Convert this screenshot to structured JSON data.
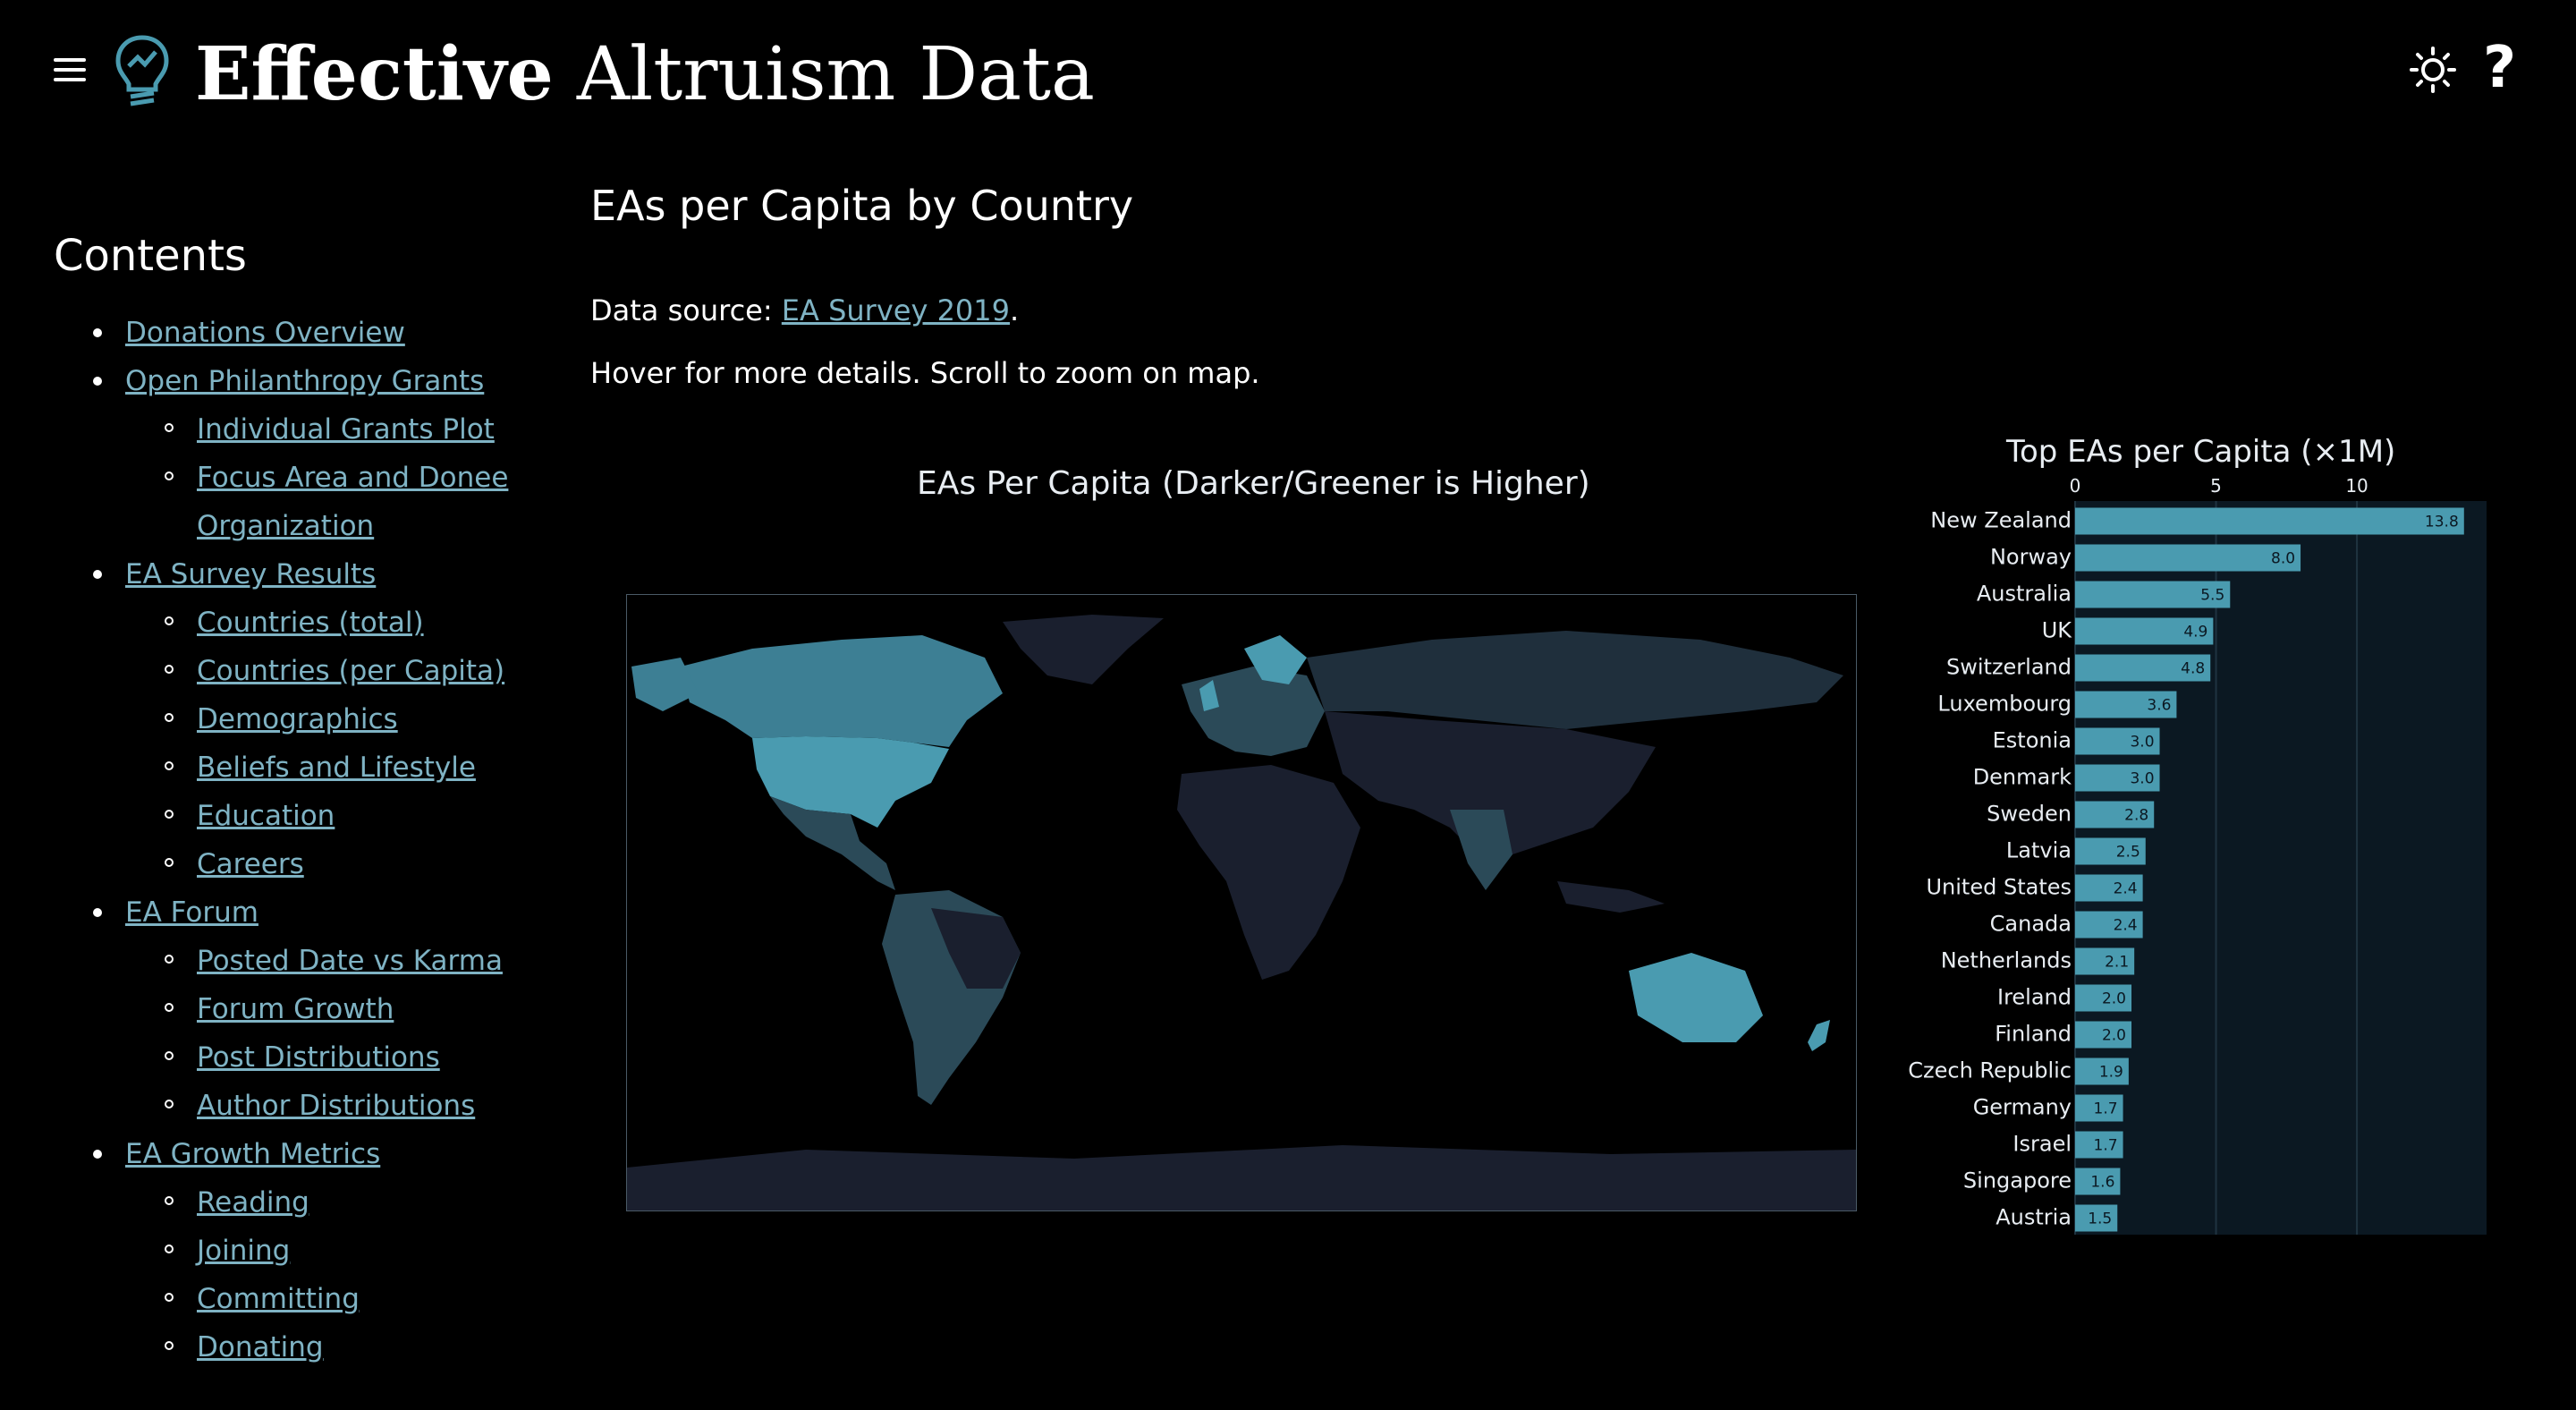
{
  "header": {
    "title_bold": "Effective",
    "title_rest": " Altruism Data",
    "icons": [
      "menu-icon",
      "lightbulb-icon",
      "sun-icon",
      "help-icon"
    ],
    "help_symbol": "?"
  },
  "sidebar": {
    "title": "Contents",
    "items": [
      {
        "label": "Donations Overview",
        "children": []
      },
      {
        "label": "Open Philanthropy Grants",
        "children": [
          "Individual Grants Plot",
          "Focus Area and Donee Organization"
        ]
      },
      {
        "label": "EA Survey Results",
        "children": [
          "Countries (total)",
          "Countries (per Capita)",
          "Demographics",
          "Beliefs and Lifestyle",
          "Education",
          "Careers"
        ]
      },
      {
        "label": "EA Forum",
        "children": [
          "Posted Date vs Karma",
          "Forum Growth",
          "Post Distributions",
          "Author Distributions"
        ]
      },
      {
        "label": "EA Growth Metrics",
        "children": [
          "Reading",
          "Joining",
          "Committing",
          "Donating"
        ]
      }
    ]
  },
  "main": {
    "heading": "EAs per Capita by Country",
    "source_prefix": "Data source: ",
    "source_link": "EA Survey 2019",
    "source_suffix": ".",
    "hint": "Hover for more details. Scroll to zoom on map.",
    "map_title": "EAs Per Capita (Darker/Greener is Higher)"
  },
  "colors": {
    "bar": "#4a9bb0",
    "plot_bg": "#0b1822",
    "map_high": "#4a9bb0",
    "map_mid": "#2b4a58",
    "map_low": "#1a1f2e",
    "link": "#7fb3c4"
  },
  "chart_data": {
    "type": "bar",
    "orientation": "horizontal",
    "title": "Top EAs per Capita (×1M)",
    "xlim": [
      0,
      14.6
    ],
    "xticks": [
      0,
      5,
      10
    ],
    "categories": [
      "New Zealand",
      "Norway",
      "Australia",
      "UK",
      "Switzerland",
      "Luxembourg",
      "Estonia",
      "Denmark",
      "Sweden",
      "Latvia",
      "United States",
      "Canada",
      "Netherlands",
      "Ireland",
      "Finland",
      "Czech Republic",
      "Germany",
      "Israel",
      "Singapore",
      "Austria"
    ],
    "values": [
      13.8,
      8.0,
      5.5,
      4.9,
      4.8,
      3.6,
      3.0,
      3.0,
      2.8,
      2.5,
      2.4,
      2.4,
      2.1,
      2.0,
      2.0,
      1.9,
      1.7,
      1.7,
      1.6,
      1.5
    ],
    "labels": [
      "13.8",
      "8.0",
      "5.5",
      "4.9",
      "4.8",
      "3.6",
      "3.0",
      "3.0",
      "2.8",
      "2.5",
      "2.4",
      "2.4",
      "2.1",
      "2.0",
      "2.0",
      "1.9",
      "1.7",
      "1.7",
      "1.6",
      "1.5"
    ]
  }
}
